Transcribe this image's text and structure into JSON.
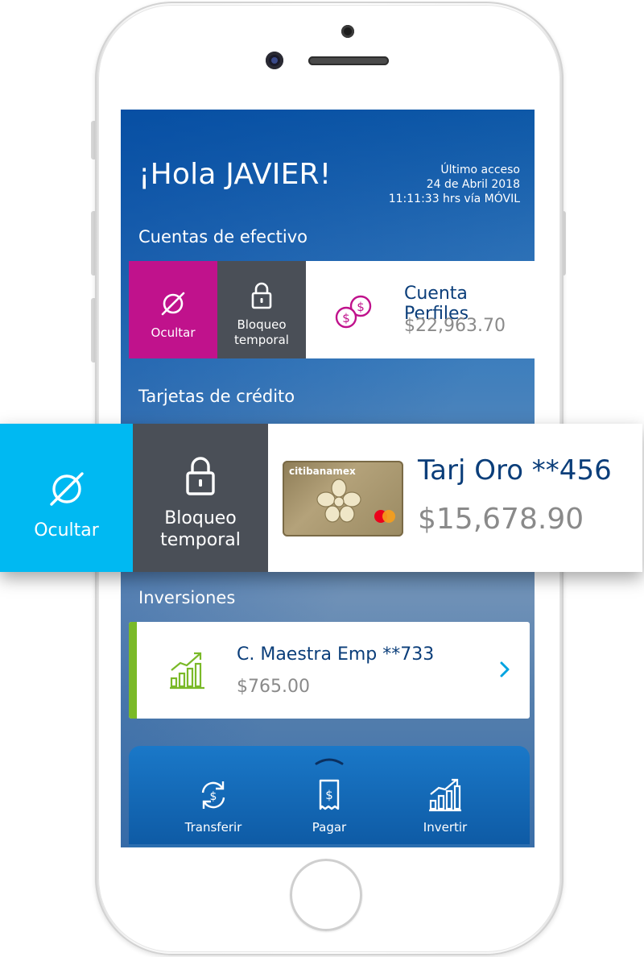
{
  "greeting": "¡Hola JAVIER!",
  "last_access": {
    "line1": "Último acceso",
    "line2": "24 de Abril 2018",
    "line3": "11:11:33 hrs vía MÓVIL"
  },
  "sections": {
    "cash": "Cuentas de efectivo",
    "credit": "Tarjetas de crédito",
    "investments": "Inversiones"
  },
  "cash_account": {
    "hide_label": "Ocultar",
    "lock_label_line1": "Bloqueo",
    "lock_label_line2": "temporal",
    "name": "Cuenta Perfiles",
    "amount": "$22,963.70",
    "icon": "coins-icon",
    "hide_color": "#c0128c"
  },
  "credit_card": {
    "hide_label": "Ocultar",
    "lock_label_line1": "Bloqueo",
    "lock_label_line2": "temporal",
    "name": "Tarj Oro **456",
    "amount": "$15,678.90",
    "card_brand": "citibanamex",
    "card_network": "mastercard",
    "hide_color": "#00b9f2"
  },
  "investment": {
    "name": "C. Maestra Emp **733",
    "amount": "$765.00",
    "icon": "growth-chart-icon",
    "accent_color": "#7ab928"
  },
  "bottom_nav": [
    {
      "label": "Transferir",
      "icon": "transfer-icon"
    },
    {
      "label": "Pagar",
      "icon": "receipt-icon"
    },
    {
      "label": "Invertir",
      "icon": "chart-icon"
    }
  ]
}
